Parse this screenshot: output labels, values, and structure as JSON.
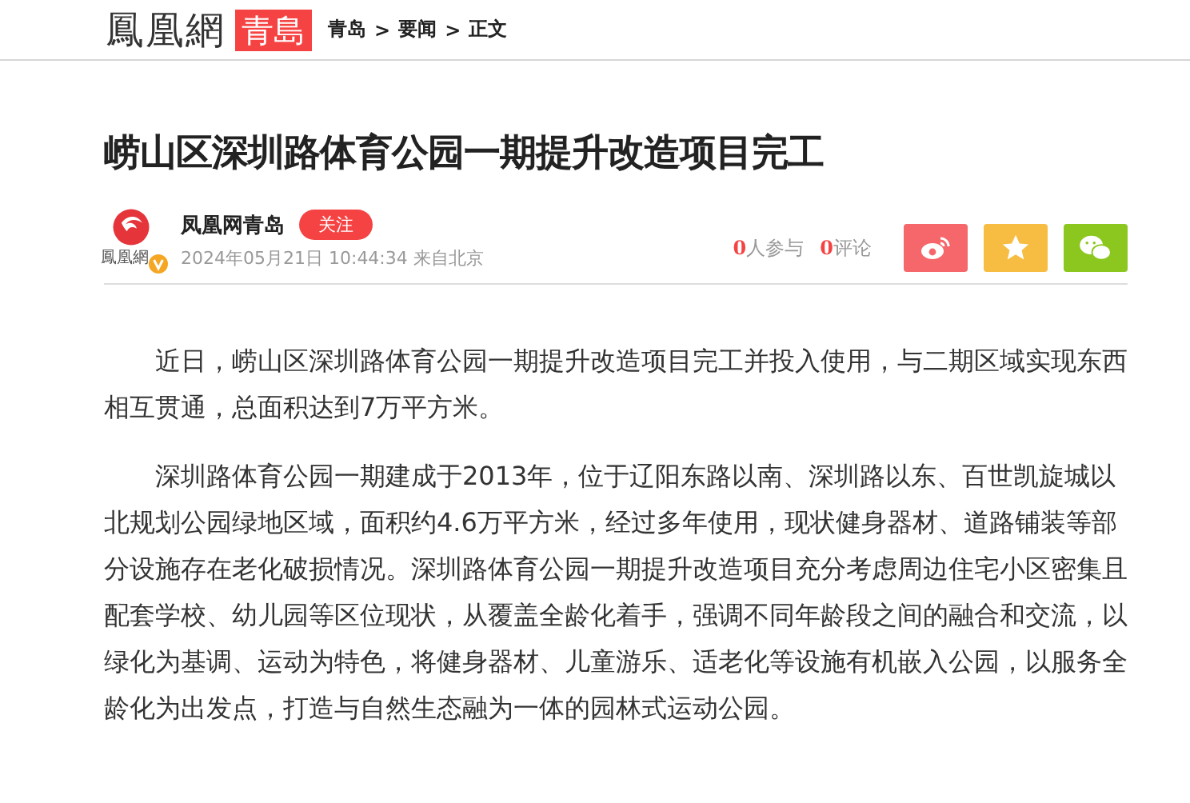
{
  "header": {
    "logo": "鳳凰網",
    "channel": "青島",
    "breadcrumb": [
      {
        "label": "青岛"
      },
      {
        "label": "要闻"
      },
      {
        "label": "正文"
      }
    ],
    "separator": ">"
  },
  "article": {
    "title": "崂山区深圳路体育公园一期提升改造项目完工",
    "author": {
      "avatar_text": "鳳凰網",
      "name": "凤凰网青岛",
      "follow": "关注",
      "verified": true,
      "meta": "2024年05月21日 10:44:34 来自北京"
    },
    "stats": [
      {
        "count": "0",
        "label": "人参与"
      },
      {
        "count": "0",
        "label": "评论"
      }
    ],
    "share": [
      {
        "kind": "weibo",
        "color": "#f5676a"
      },
      {
        "kind": "favorite",
        "color": "#f6bd42"
      },
      {
        "kind": "wechat",
        "color": "#8cc71f"
      }
    ],
    "paragraphs": [
      "近日，崂山区深圳路体育公园一期提升改造项目完工并投入使用，与二期区域实现东西相互贯通，总面积达到7万平方米。",
      "深圳路体育公园一期建成于2013年，位于辽阳东路以南、深圳路以东、百世凯旋城以北规划公园绿地区域，面积约4.6万平方米，经过多年使用，现状健身器材、道路铺装等部分设施存在老化破损情况。深圳路体育公园一期提升改造项目充分考虑周边住宅小区密集且配套学校、幼儿园等区位现状，从覆盖全龄化着手，强调不同年龄段之间的融合和交流，以绿化为基调、运动为特色，将健身器材、儿童游乐、适老化等设施有机嵌入公园，以服务全龄化为出发点，打造与自然生态融为一体的园林式运动公园。"
    ]
  }
}
